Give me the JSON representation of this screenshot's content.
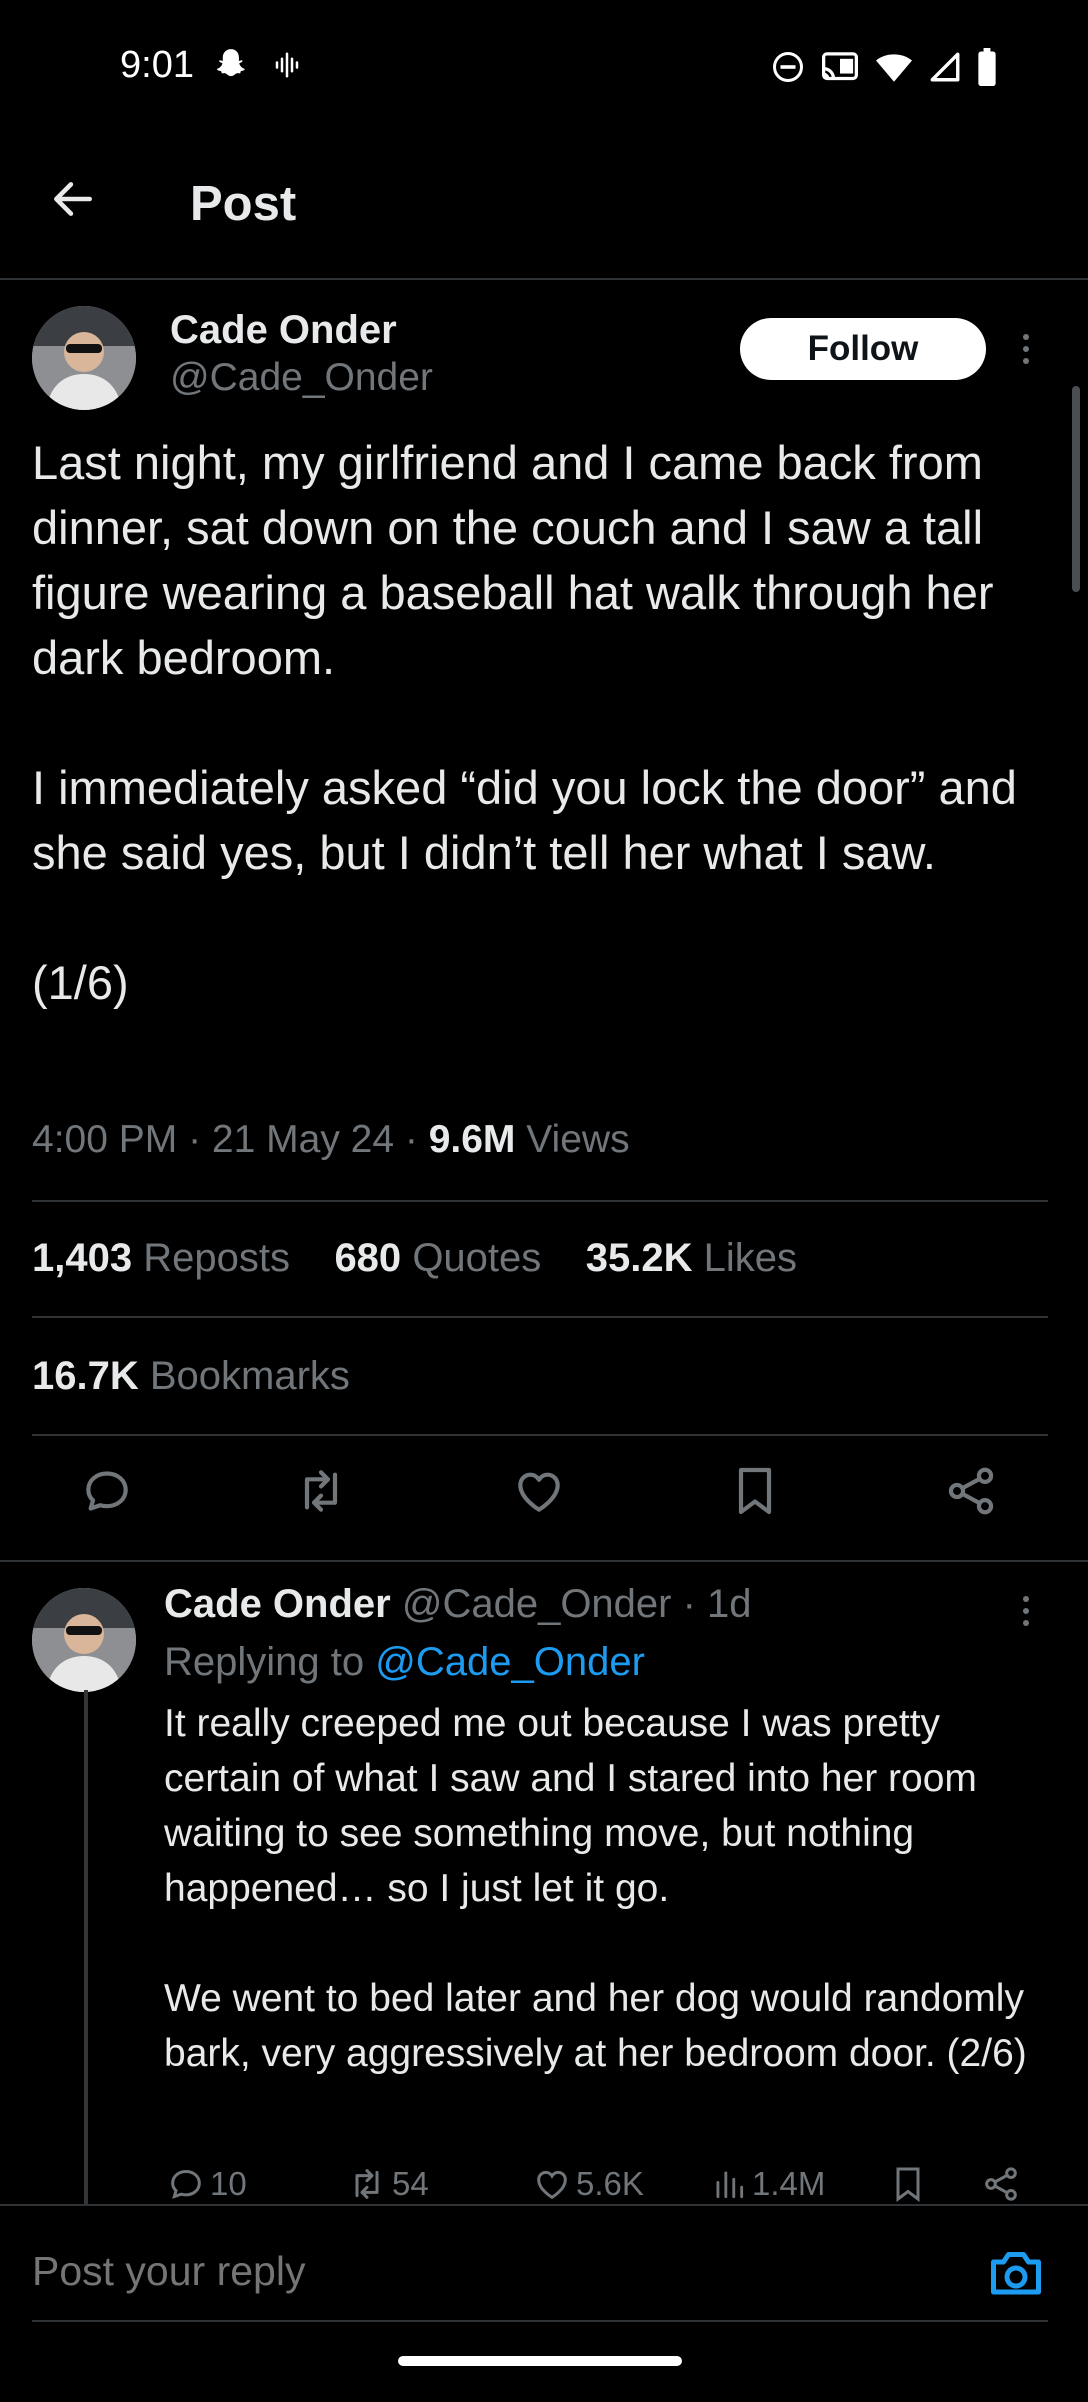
{
  "status_bar": {
    "time": "9:01"
  },
  "header": {
    "title": "Post"
  },
  "post": {
    "author_name": "Cade Onder",
    "author_handle": "@Cade_Onder",
    "follow_label": "Follow",
    "text": "Last night, my girlfriend and I came back from dinner, sat down on the couch and I saw a tall figure wearing a baseball hat walk through her dark bedroom.\n\nI immediately asked “did you lock the door” and she said yes, but I didn’t tell her what I saw.\n\n(1/6)",
    "time": "4:00 PM",
    "date": "21 May 24",
    "views_count": "9.6M",
    "views_label": "Views",
    "reposts_count": "1,403",
    "reposts_label": "Reposts",
    "quotes_count": "680",
    "quotes_label": "Quotes",
    "likes_count": "35.2K",
    "likes_label": "Likes",
    "bookmarks_count": "16.7K",
    "bookmarks_label": "Bookmarks"
  },
  "reply": {
    "author_name": "Cade Onder",
    "author_handle": "@Cade_Onder",
    "age": "· 1d",
    "replying_prefix": "Replying to",
    "replying_handle": "@Cade_Onder",
    "text": "It really creeped me out because I was pretty certain of what I saw and I stared into her room waiting to see something move, but nothing happened… so I just let it go.\n\nWe went to bed later and her dog would randomly bark, very aggressively at her bedroom door. (2/6)",
    "replies": "10",
    "reposts": "54",
    "likes": "5.6K",
    "views": "1.4M"
  },
  "composer": {
    "placeholder": "Post your reply"
  },
  "colors": {
    "accent": "#1d9bf0",
    "background": "#000000",
    "text": "#e7e9ea",
    "muted": "#71767b",
    "divider": "#2f3336"
  },
  "icons": [
    "back-arrow-icon",
    "snapchat-icon",
    "voice-icon",
    "dnd-icon",
    "cast-icon",
    "wifi-icon",
    "signal-icon",
    "battery-icon",
    "more-icon",
    "reply-icon",
    "repost-icon",
    "like-icon",
    "bookmark-icon",
    "share-icon",
    "views-icon",
    "camera-icon"
  ]
}
